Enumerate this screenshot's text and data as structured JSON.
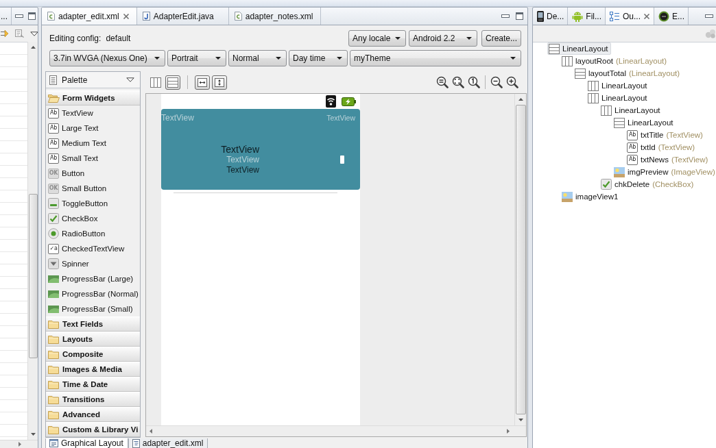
{
  "left_view": {
    "tab_label": "..."
  },
  "editor": {
    "tabs": [
      {
        "label": "adapter_edit.xml",
        "kind": "xml",
        "selected": true
      },
      {
        "label": "AdapterEdit.java",
        "kind": "java",
        "selected": false
      },
      {
        "label": "adapter_notes.xml",
        "kind": "xml",
        "selected": false
      }
    ],
    "config": {
      "label": "Editing config:",
      "value": "default",
      "locale": "Any locale",
      "target": "Android 2.2",
      "create_button": "Create..."
    },
    "device_options": [
      "3.7in WVGA (Nexus One)",
      "Portrait",
      "Normal",
      "Day time",
      "myTheme"
    ],
    "palette": {
      "title": "Palette",
      "groups": [
        {
          "label": "Form Widgets",
          "expanded": true,
          "items": [
            {
              "label": "TextView",
              "kind": "text",
              "icon_text": "Ab"
            },
            {
              "label": "Large Text",
              "kind": "text",
              "icon_text": "Ab"
            },
            {
              "label": "Medium Text",
              "kind": "text",
              "icon_text": "Ab"
            },
            {
              "label": "Small Text",
              "kind": "text",
              "icon_text": "Ab"
            },
            {
              "label": "Button",
              "kind": "button",
              "icon_text": "OK"
            },
            {
              "label": "Small Button",
              "kind": "button",
              "icon_text": "OK"
            },
            {
              "label": "ToggleButton",
              "kind": "toggle"
            },
            {
              "label": "CheckBox",
              "kind": "checkbox"
            },
            {
              "label": "RadioButton",
              "kind": "radio"
            },
            {
              "label": "CheckedTextView",
              "kind": "checked_text",
              "icon_text": "✓a"
            },
            {
              "label": "Spinner",
              "kind": "spinner"
            },
            {
              "label": "ProgressBar (Large)",
              "kind": "progress"
            },
            {
              "label": "ProgressBar (Normal)",
              "kind": "progress"
            },
            {
              "label": "ProgressBar (Small)",
              "kind": "progress"
            }
          ]
        },
        {
          "label": "Text Fields",
          "expanded": false
        },
        {
          "label": "Layouts",
          "expanded": false
        },
        {
          "label": "Composite",
          "expanded": false
        },
        {
          "label": "Images & Media",
          "expanded": false
        },
        {
          "label": "Time & Date",
          "expanded": false
        },
        {
          "label": "Transitions",
          "expanded": false
        },
        {
          "label": "Advanced",
          "expanded": false
        },
        {
          "label": "Custom & Library Vi",
          "expanded": false
        }
      ]
    },
    "canvas_toolbar": {
      "layout_toggles": [
        {
          "kind": "columns",
          "selected": false
        },
        {
          "kind": "rows",
          "selected": true
        }
      ],
      "size_toggles": [
        {
          "kind": "fit_width",
          "on": true
        },
        {
          "kind": "fit_height",
          "on": true
        }
      ]
    },
    "preview": {
      "header_left": "TextView",
      "header_right": "TextView",
      "title": "TextView",
      "id": "TextView",
      "news": "TextView"
    },
    "bottom_tabs": [
      {
        "label": "Graphical Layout",
        "kind": "layout",
        "selected": true
      },
      {
        "label": "adapter_edit.xml",
        "kind": "source",
        "selected": false
      }
    ]
  },
  "outline": {
    "tabs": [
      {
        "label": "De...",
        "kind": "device",
        "selected": false
      },
      {
        "label": "Fil...",
        "kind": "android",
        "selected": false
      },
      {
        "label": "Ou...",
        "kind": "outline",
        "selected": true
      },
      {
        "label": "E...",
        "kind": "emulator",
        "selected": false
      }
    ],
    "tree": [
      {
        "name": "LinearLayout",
        "kind": "vertical",
        "selected": true,
        "children": [
          {
            "name": "layoutRoot",
            "type": "(LinearLayout)",
            "kind": "horizontal",
            "selected": false,
            "children": [
              {
                "name": "layoutTotal",
                "type": "(LinearLayout)",
                "kind": "vertical",
                "selected": false,
                "children": [
                  {
                    "name": "LinearLayout",
                    "kind": "horizontal",
                    "selected": false
                  },
                  {
                    "name": "LinearLayout",
                    "kind": "horizontal",
                    "selected": false,
                    "children": [
                      {
                        "name": "LinearLayout",
                        "kind": "horizontal",
                        "selected": false,
                        "children": [
                          {
                            "name": "LinearLayout",
                            "kind": "vertical",
                            "selected": false,
                            "children": [
                              {
                                "name": "txtTitle",
                                "type": "(TextView)",
                                "kind": "text",
                                "icon_text": "Ab",
                                "selected": false
                              },
                              {
                                "name": "txtId",
                                "type": "(TextView)",
                                "kind": "text",
                                "icon_text": "Ab",
                                "selected": false
                              },
                              {
                                "name": "txtNews",
                                "type": "(TextView)",
                                "kind": "text",
                                "icon_text": "Ab",
                                "selected": false
                              }
                            ]
                          },
                          {
                            "name": "imgPreview",
                            "type": "(ImageView)",
                            "kind": "image",
                            "selected": false
                          }
                        ]
                      },
                      {
                        "name": "chkDelete",
                        "type": "(CheckBox)",
                        "kind": "checkbox",
                        "selected": false
                      }
                    ]
                  }
                ]
              }
            ]
          },
          {
            "name": "imageView1",
            "kind": "image",
            "selected": false
          }
        ]
      }
    ]
  }
}
